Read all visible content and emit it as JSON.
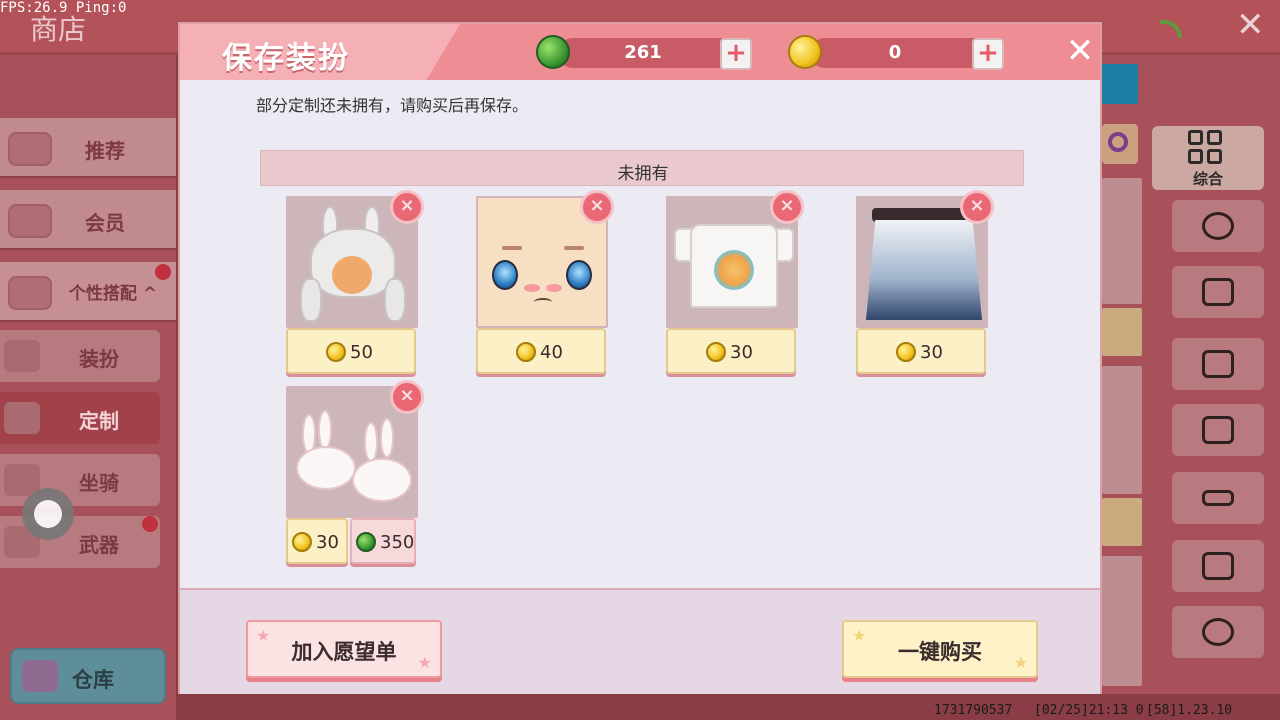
{
  "status": {
    "fps": "FPS:26.9  Ping:0"
  },
  "background": {
    "shop_title": "商店",
    "category_label": "综合",
    "nav_tabs": [
      {
        "label": "推荐"
      },
      {
        "label": "会员"
      },
      {
        "label": "个性搭配 ^"
      }
    ],
    "sub_tabs": [
      {
        "label": "装扮"
      },
      {
        "label": "定制"
      },
      {
        "label": "坐骑"
      },
      {
        "label": "武器"
      }
    ],
    "warehouse_label": "仓库",
    "footer": {
      "id": "1731790537",
      "date": "[02/25]21:13 0",
      "time": "[58]1.23.10"
    }
  },
  "dialog": {
    "title": "保存装扮",
    "currencies": {
      "gems": "261",
      "coins": "0"
    },
    "message": "部分定制还未拥有，请购买后再保存。",
    "section_label": "未拥有",
    "items": [
      {
        "name": "bunny-ear-hair",
        "prices": [
          {
            "currency": "coin",
            "value": "50"
          }
        ]
      },
      {
        "name": "teary-face",
        "prices": [
          {
            "currency": "coin",
            "value": "40"
          }
        ]
      },
      {
        "name": "palm-tree-tshirt",
        "prices": [
          {
            "currency": "coin",
            "value": "30"
          }
        ]
      },
      {
        "name": "gradient-floral-skirt",
        "prices": [
          {
            "currency": "coin",
            "value": "30"
          }
        ]
      },
      {
        "name": "bunny-slippers",
        "prices": [
          {
            "currency": "coin",
            "value": "30"
          },
          {
            "currency": "gem",
            "value": "350"
          }
        ]
      }
    ],
    "buttons": {
      "wishlist": "加入愿望单",
      "buy_all": "一键购买"
    }
  },
  "colors": {
    "header": "#ee8d94",
    "price_button": "#fbf0c6",
    "remove_button": "#ea6874",
    "gem": "#2f8b2a",
    "coin": "#f2c21e"
  },
  "icons": {
    "close": "close-icon",
    "add": "plus-icon",
    "remove": "remove-x-icon",
    "gem": "gem-icon",
    "coin": "coin-icon"
  }
}
